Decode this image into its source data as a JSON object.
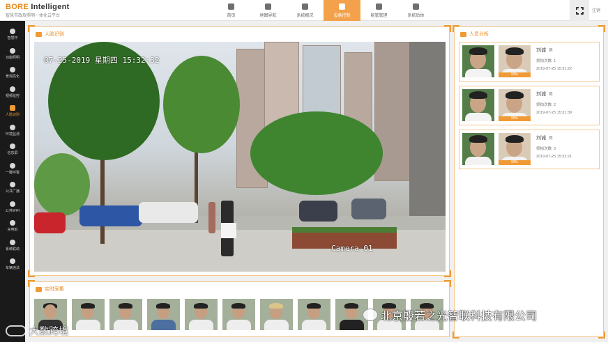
{
  "brand": {
    "name_a": "BORE",
    "name_b": "Intelligent",
    "subtitle": "智慧市政及照明一体化云平台"
  },
  "nav": [
    {
      "label": "首页",
      "icon": "home-icon"
    },
    {
      "label": "地图导航",
      "icon": "map-icon"
    },
    {
      "label": "系统概况",
      "icon": "info-icon"
    },
    {
      "label": "设备控制",
      "icon": "device-icon",
      "active": true
    },
    {
      "label": "能管管理",
      "icon": "energy-icon"
    },
    {
      "label": "系统后体",
      "icon": "backend-icon"
    }
  ],
  "logout": "注销",
  "sidebar": [
    {
      "label": "智慧杆",
      "icon": "pole-icon"
    },
    {
      "label": "功能照明",
      "icon": "light-icon"
    },
    {
      "label": "景观亮化",
      "icon": "moon-icon"
    },
    {
      "label": "视频监控",
      "icon": "camera-icon"
    },
    {
      "label": "人脸识别",
      "icon": "face-icon",
      "active": true
    },
    {
      "label": "环境监测",
      "icon": "environment-icon"
    },
    {
      "label": "信息屏",
      "icon": "screen-icon"
    },
    {
      "label": "一键呼警",
      "icon": "alarm-icon"
    },
    {
      "label": "公共广播",
      "icon": "broadcast-icon"
    },
    {
      "label": "公共WIFI",
      "icon": "wifi-icon"
    },
    {
      "label": "充电桩",
      "icon": "charger-icon"
    },
    {
      "label": "系统联动",
      "icon": "link-icon"
    },
    {
      "label": "车辆违法",
      "icon": "car-icon"
    }
  ],
  "face_panel": {
    "title": "人脸识别"
  },
  "video": {
    "timestamp": "07-25-2019 星期四 15:32:32",
    "camera_label": "Camera 01"
  },
  "analysis_panel": {
    "title": "人员分析"
  },
  "records": [
    {
      "name": "刘诚",
      "gender": "男",
      "match": "99%",
      "count_label": "抓拍次数: 1",
      "time": "2019-07-25 15:31:22"
    },
    {
      "name": "刘诚",
      "gender": "男",
      "match": "99%",
      "count_label": "抓拍次数: 2",
      "time": "2019-07-25 15:31:39"
    },
    {
      "name": "刘诚",
      "gender": "男",
      "match": "99%",
      "count_label": "抓拍次数: 3",
      "time": "2019-07-25 15:32:21"
    }
  ],
  "capture_panel": {
    "title": "实时采集"
  },
  "thumbs_count_label": "",
  "watermark": {
    "company": "北京殷若之光智联科技有限公司",
    "bottom_left": "大数跨境"
  },
  "colors": {
    "accent": "#f09a36",
    "sidebar_bg": "#1a1a1a"
  }
}
